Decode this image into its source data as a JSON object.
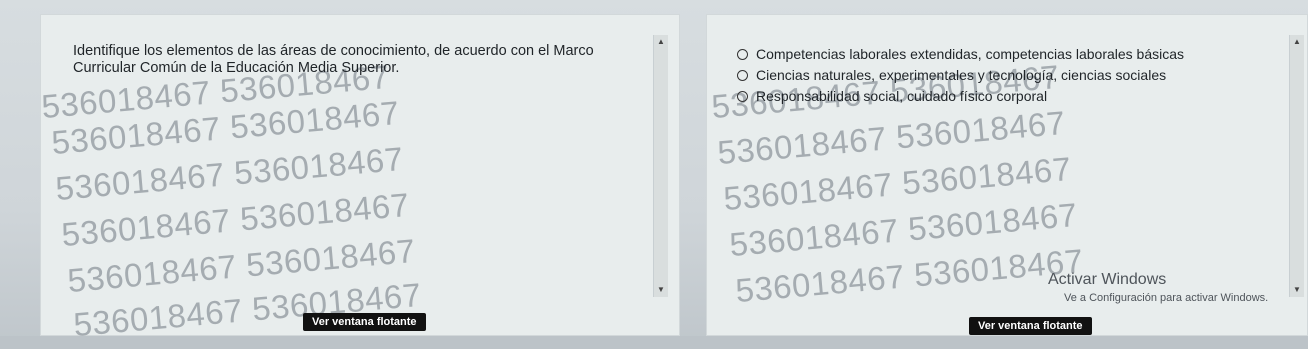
{
  "question": {
    "text": "Identifique los elementos de las áreas de conocimiento, de acuerdo con el Marco Curricular Común de la Educación Media Superior."
  },
  "options": [
    {
      "label": "Competencias laborales extendidas, competencias laborales básicas"
    },
    {
      "label": "Ciencias naturales, experimentales y tecnología, ciencias sociales"
    },
    {
      "label": "Responsabilidad social, cuidado físico corporal"
    }
  ],
  "watermark": {
    "text": "536018467 536018467"
  },
  "buttons": {
    "float_left": "Ver ventana flotante",
    "float_right": "Ver ventana flotante"
  },
  "scrollbar": {
    "up_glyph": "▲",
    "down_glyph": "▼"
  },
  "activation": {
    "title": "Activar Windows",
    "subtitle": "Ve a Configuración para activar Windows."
  }
}
